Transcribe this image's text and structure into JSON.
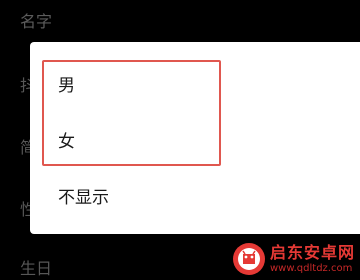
{
  "background": {
    "rows": [
      "名字",
      "抖",
      "简",
      "性",
      "生日"
    ]
  },
  "dialog": {
    "options": [
      "男",
      "女",
      "不显示"
    ]
  },
  "watermark": {
    "title": "启东安卓网",
    "url": "www.qdltdz.com"
  },
  "colors": {
    "highlight": "#e0574f",
    "watermark": "#e53935"
  }
}
